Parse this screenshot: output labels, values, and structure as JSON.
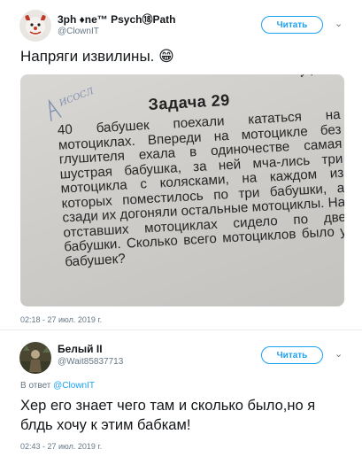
{
  "tweet1": {
    "display_name": "3ph ♦ne™ Psych⑱Path",
    "handle": "@ClownIT",
    "follow_label": "Читать",
    "text": "Напряги извилины. 😁",
    "photo": {
      "title": "Задача 29",
      "body": "40 бабушек поехали кататься на мотоциклах. Впереди на мотоцикле без глушителя ехала в одиночестве самая шустрая бабушка, за ней мча-лись три мотоцикла с колясками, на каждом из которых поместилось по три бабушки, а сзади их догоняли остальные мотоциклы. На отставших мотоциклах сидело по две бабушки. Сколько всего мотоциклов было у бабушек?"
    },
    "timestamp": "02:18 - 27 июл. 2019 г."
  },
  "tweet2": {
    "display_name": "Белый II",
    "handle": "@Wait85837713",
    "follow_label": "Читать",
    "reply_prefix": "В ответ",
    "reply_handle": "@ClownIT",
    "text": "Хер его знает чего там и сколько было,но я блдь хочу к этим бабкам!",
    "timestamp": "02:43 - 27 июл. 2019 г."
  },
  "icons": {
    "chevron": "chevron-down-icon"
  },
  "colors": {
    "accent": "#1da1f2",
    "secondary_text": "#657786",
    "divider": "#e6ecf0"
  }
}
